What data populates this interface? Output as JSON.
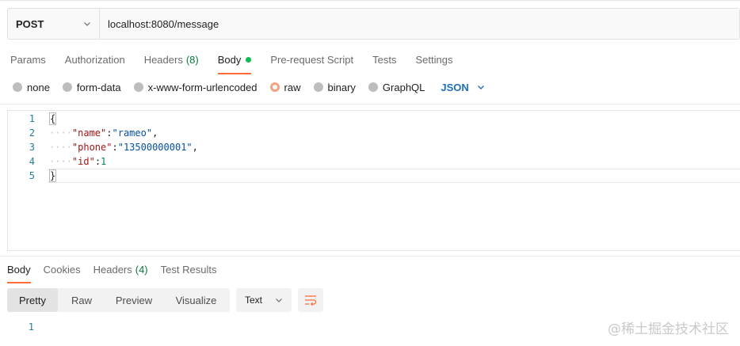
{
  "request": {
    "method": "POST",
    "url": "localhost:8080/message"
  },
  "request_tabs": [
    {
      "label": "Params"
    },
    {
      "label": "Authorization"
    },
    {
      "label": "Headers",
      "count": "(8)"
    },
    {
      "label": "Body",
      "active": true
    },
    {
      "label": "Pre-request Script"
    },
    {
      "label": "Tests"
    },
    {
      "label": "Settings"
    }
  ],
  "body_types": [
    {
      "label": "none"
    },
    {
      "label": "form-data"
    },
    {
      "label": "x-www-form-urlencoded"
    },
    {
      "label": "raw",
      "selected": true
    },
    {
      "label": "binary"
    },
    {
      "label": "GraphQL"
    }
  ],
  "raw_language": "JSON",
  "editor": {
    "line_numbers": [
      "1",
      "2",
      "3",
      "4",
      "5"
    ],
    "line1": "{",
    "line2_key": "\"name\"",
    "line2_val": "\"rameo\"",
    "line3_key": "\"phone\"",
    "line3_val": "\"13500000001\"",
    "line4_key": "\"id\"",
    "line4_val": "1",
    "line5": "}"
  },
  "response_tabs": [
    {
      "label": "Body",
      "active": true
    },
    {
      "label": "Cookies"
    },
    {
      "label": "Headers",
      "count": "(4)"
    },
    {
      "label": "Test Results"
    }
  ],
  "view_modes": [
    "Pretty",
    "Raw",
    "Preview",
    "Visualize"
  ],
  "active_view": "Pretty",
  "response_format": "Text",
  "response_line_number": "1",
  "watermark": "@稀土掘金技术社区",
  "colors": {
    "accent": "#ff6c37",
    "status_green": "#0cbb52",
    "json_blue": "#1d6fbf"
  }
}
